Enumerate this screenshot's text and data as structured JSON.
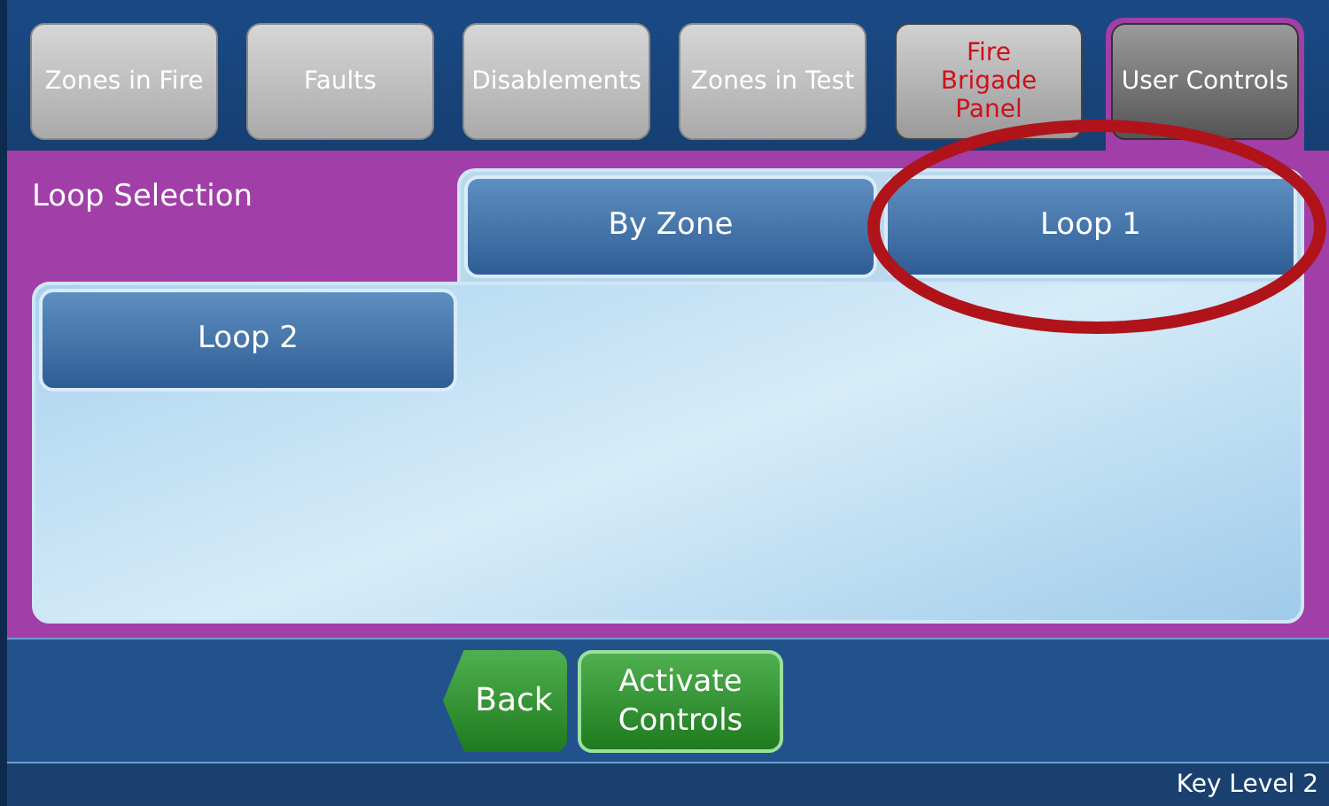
{
  "tabs": [
    {
      "label": "Zones in Fire",
      "selected": false,
      "kind": "normal"
    },
    {
      "label": "Faults",
      "selected": false,
      "kind": "normal"
    },
    {
      "label": "Disablements",
      "selected": false,
      "kind": "normal"
    },
    {
      "label": "Zones in Test",
      "selected": false,
      "kind": "normal"
    },
    {
      "label": "Fire Brigade Panel",
      "selected": false,
      "kind": "alert"
    },
    {
      "label": "User Controls",
      "selected": true,
      "kind": "normal"
    }
  ],
  "panel": {
    "title": "Loop Selection",
    "options": [
      {
        "label": "By Zone"
      },
      {
        "label": "Loop 1"
      },
      {
        "label": "Loop 2"
      }
    ]
  },
  "actions": [
    {
      "label": "Back",
      "kind": "back"
    },
    {
      "label": "Activate Controls",
      "kind": "action"
    }
  ],
  "status_bar": {
    "text": "Key Level 2"
  }
}
